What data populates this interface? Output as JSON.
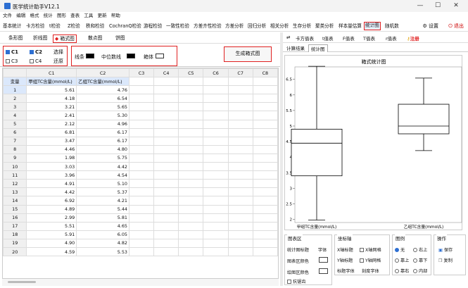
{
  "window": {
    "title": "医学统计助手V12.1",
    "minimize": "—",
    "maximize": "☐",
    "close": "✕"
  },
  "menu": [
    "文件",
    "编辑",
    "格式",
    "统计",
    "图形",
    "查表",
    "工具",
    "更新",
    "帮助"
  ],
  "toolbar": {
    "items": [
      "基本统计",
      "卡方检验",
      "t检验",
      "Z检验",
      "秩和检验",
      "CochranQ检验",
      "游程检验",
      "一致性检验",
      "方差齐性检验",
      "方差分析",
      "回归分析",
      "相关分析",
      "生存分析",
      "聚类分析",
      "样本量估算",
      "统计图",
      "随机数"
    ],
    "selected": "统计图",
    "settings": "设置",
    "exit": "退出"
  },
  "chart_tabs": {
    "items": [
      "条形图",
      "折线图",
      "箱式图",
      "散点图",
      "饼图"
    ],
    "selected": "箱式图"
  },
  "options": {
    "columns": [
      {
        "label": "C1",
        "checked": true
      },
      {
        "label": "C2",
        "checked": true
      },
      {
        "label": "C3",
        "checked": false
      },
      {
        "label": "C4",
        "checked": false
      }
    ],
    "select_label": "选择",
    "restore_label": "还原",
    "line_label": "线条",
    "median_label": "中位数线",
    "box_label": "箱体",
    "generate_button": "生成箱式图"
  },
  "grid": {
    "columns": [
      "C1",
      "C2",
      "C3",
      "C4",
      "C5",
      "C6",
      "C7",
      "C8"
    ],
    "var_header": "变量",
    "var_names": [
      "甲组TC含量(mmol/L)",
      "乙组TC含量(mmol/L)"
    ],
    "rows": [
      [
        "1",
        "5.61",
        "4.76"
      ],
      [
        "2",
        "4.18",
        "6.54"
      ],
      [
        "3",
        "3.21",
        "5.65"
      ],
      [
        "4",
        "2.41",
        "5.30"
      ],
      [
        "5",
        "2.12",
        "4.96"
      ],
      [
        "6",
        "6.81",
        "6.17"
      ],
      [
        "7",
        "3.47",
        "6.17"
      ],
      [
        "8",
        "4.46",
        "4.80"
      ],
      [
        "9",
        "1.98",
        "5.75"
      ],
      [
        "10",
        "3.03",
        "4.42"
      ],
      [
        "11",
        "3.96",
        "4.54"
      ],
      [
        "12",
        "4.91",
        "5.10"
      ],
      [
        "13",
        "4.42",
        "5.37"
      ],
      [
        "14",
        "6.92",
        "4.21"
      ],
      [
        "15",
        "4.89",
        "5.44"
      ],
      [
        "16",
        "2.99",
        "5.81"
      ],
      [
        "17",
        "5.51",
        "4.65"
      ],
      [
        "18",
        "5.91",
        "6.05"
      ],
      [
        "19",
        "4.90",
        "4.82"
      ],
      [
        "20",
        "4.59",
        "5.53"
      ]
    ]
  },
  "right_tabs": {
    "items": [
      "⇄",
      "卡方值表",
      "t值表",
      "F值表",
      "T值表",
      "r值表"
    ],
    "register": "注册"
  },
  "result_tabs": {
    "items": [
      "计算结果",
      "统计图"
    ],
    "selected": "统计图"
  },
  "chart_data": {
    "type": "box",
    "title": "箱式统计图",
    "categories": [
      "甲组TC含量(mmol/L)",
      "乙组TC含量(mmol/L)"
    ],
    "boxes": [
      {
        "min": 1.98,
        "q1": 3.4,
        "median": 4.45,
        "q3": 4.9,
        "max": 6.92
      },
      {
        "min": 4.21,
        "q1": 4.75,
        "median": 5.0,
        "q3": 5.7,
        "max": 6.54
      }
    ],
    "ylim": [
      1.9,
      6.9
    ],
    "yticks": [
      "2",
      "2.5",
      "3",
      "3.5",
      "4",
      "4.5",
      "5",
      "5.5",
      "6",
      "6.5"
    ],
    "box_color": "#000000",
    "grid": false
  },
  "settings": {
    "plot_area": {
      "title": "图表区",
      "items": [
        "统计图标题",
        "字体",
        "图表区颜色",
        "绘图区颜色",
        "抗锯齿"
      ]
    },
    "axis": {
      "title": "坐标轴",
      "items": [
        "X轴标题",
        "X轴网格",
        "Y轴标题",
        "Y轴网格",
        "标题字体",
        "刻度字体"
      ]
    },
    "legend": {
      "title": "图例",
      "items": [
        "无",
        "右上",
        "靠上",
        "靠下",
        "靠右",
        "内部"
      ]
    },
    "ops": {
      "title": "操作",
      "save": "保存",
      "copy": "复制"
    }
  }
}
